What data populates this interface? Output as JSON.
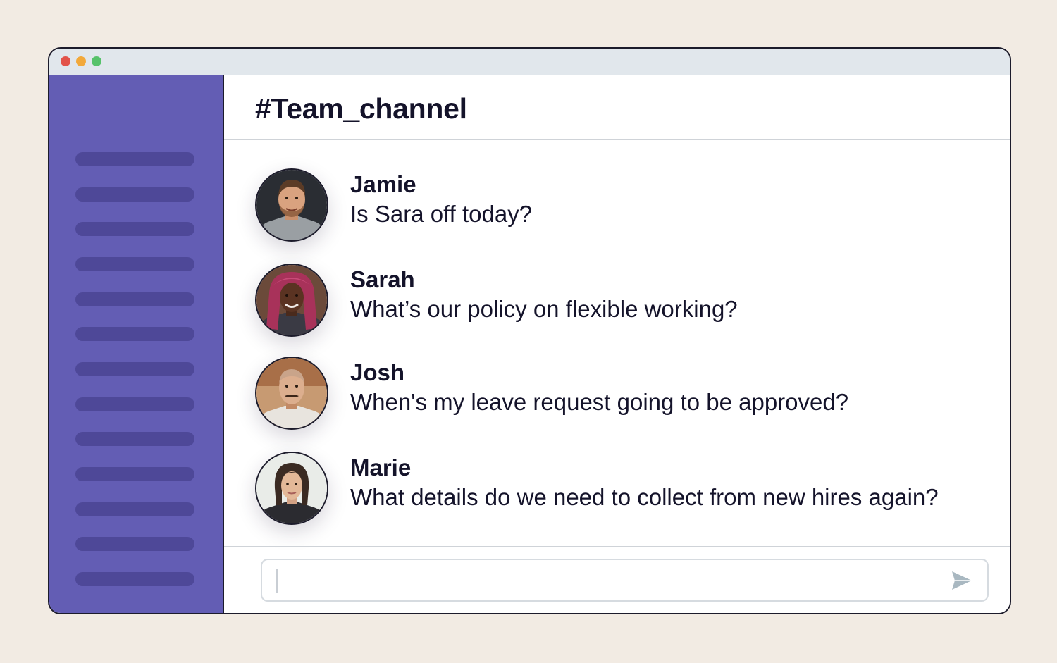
{
  "window": {
    "controls": [
      "close",
      "minimize",
      "maximize"
    ],
    "control_colors": {
      "close": "#e2534a",
      "minimize": "#f2a93b",
      "maximize": "#56c26a"
    }
  },
  "sidebar": {
    "color": "#635db4",
    "placeholder_item_count": 13
  },
  "channel": {
    "title": "#Team_channel"
  },
  "messages": [
    {
      "name": "Jamie",
      "text": "Is Sara off today?"
    },
    {
      "name": "Sarah",
      "text": "What’s our policy on flexible working?"
    },
    {
      "name": "Josh",
      "text": "When's my leave request going to be approved?"
    },
    {
      "name": "Marie",
      "text": "What details do we need to collect from new hires again?"
    }
  ],
  "composer": {
    "value": "",
    "send_icon": "send-icon"
  }
}
